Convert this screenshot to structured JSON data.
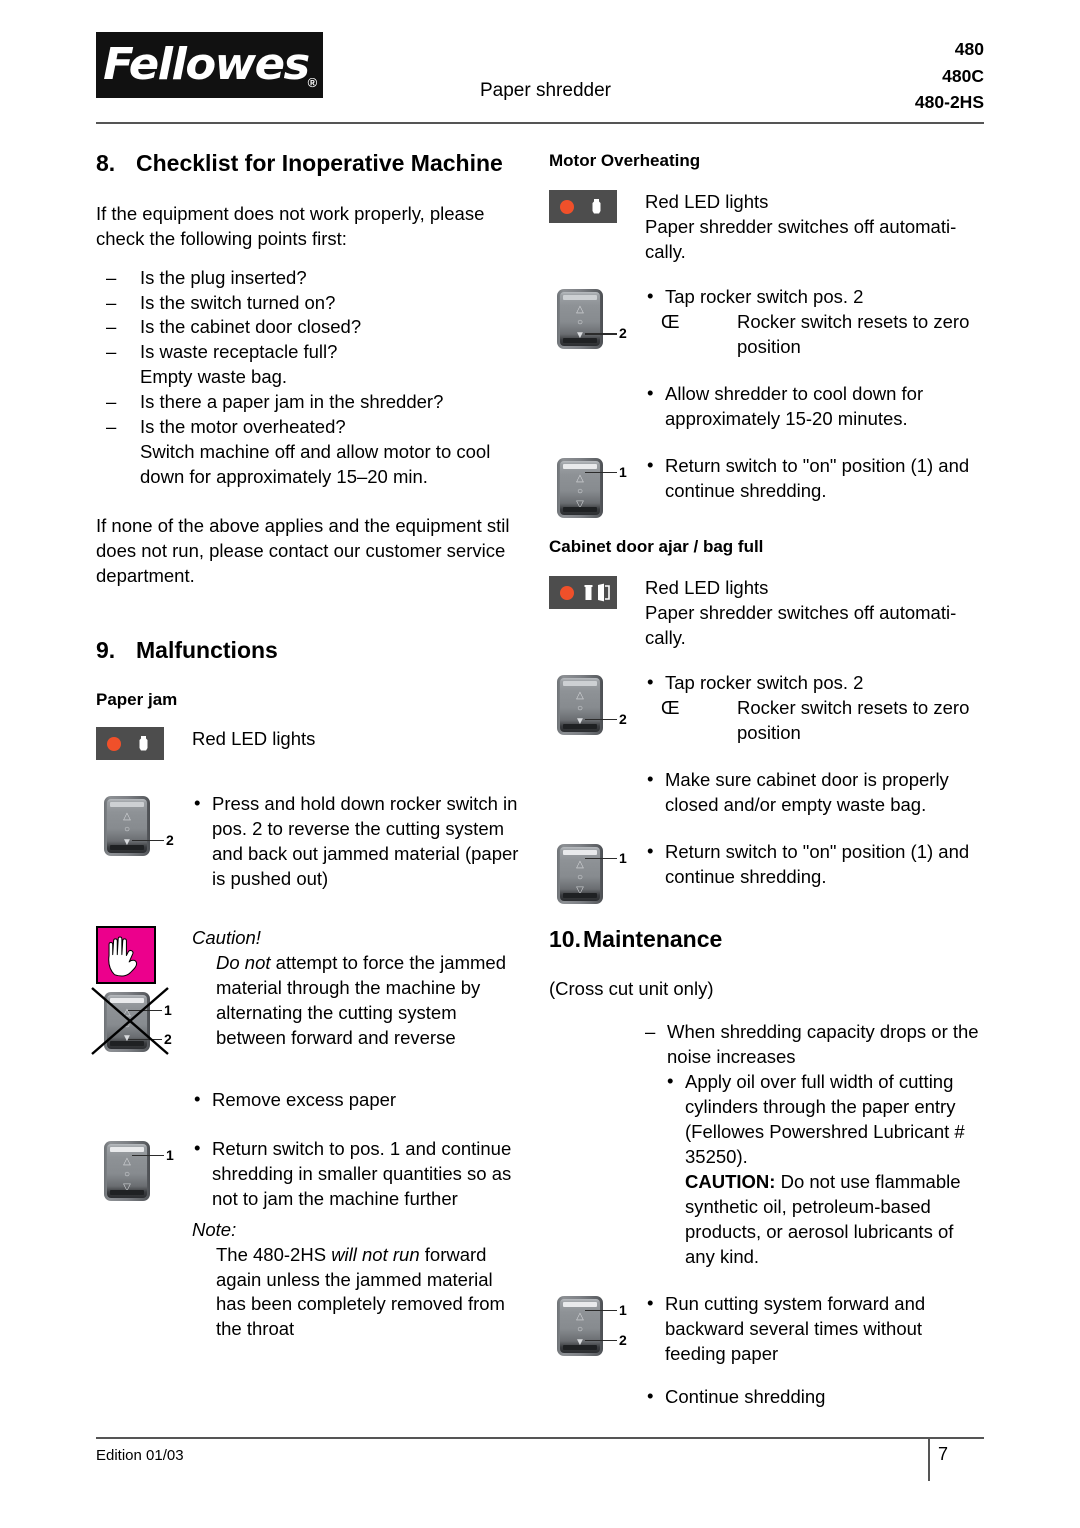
{
  "header": {
    "logo_text": "Fellowes",
    "logo_reg": "®",
    "subtitle": "Paper shredder",
    "models": [
      "480",
      "480C",
      "480-2HS"
    ]
  },
  "left_column": {
    "section8": {
      "number": "8.",
      "title": "Checklist for Inoperative Machine",
      "intro": "If  the equipment does not work properly, please check the following points first:",
      "checklist": [
        "Is the plug inserted?",
        "Is the switch turned on?",
        "Is the cabinet door closed?",
        "Is waste receptacle full?",
        "Is there a paper jam in the shredder?",
        "Is the motor overheated?"
      ],
      "checklist_note_waste": "Empty waste bag.",
      "checklist_note_motor": "Switch machine off and allow motor to cool down for approximately 15–20 min.",
      "closing": "If none of the above applies and the equipment stil does not run, please contact our customer service department."
    },
    "section9": {
      "number": "9.",
      "title": "Malfunctions",
      "paper_jam": {
        "heading": "Paper jam",
        "led_text": "Red LED lights",
        "bullet1": "Press and hold down rocker switch in pos. 2 to reverse the cutting system and back out jammed material (paper is pushed out)",
        "switch1_label": "2",
        "caution_title": "Caution!",
        "caution_emph": "Do not",
        "caution_body": " attempt to force the jammed material through the machine by alternating the cutting system between forward and reverse",
        "crossed_label_1": "1",
        "crossed_label_2": "2",
        "bullet2": "Remove excess paper",
        "bullet3": "Return switch to pos. 1 and continue shredding in smaller quantities so as not to jam the machine further",
        "switch2_label": "1",
        "note_title": "Note:",
        "note_pre": "The 480-2HS ",
        "note_emph": "will not run",
        "note_post": " forward again unless the jammed material has been completely removed from the throat"
      }
    }
  },
  "right_column": {
    "motor_overheating": {
      "heading": "Motor Overheating",
      "led_text_1": "Red LED lights",
      "led_text_2": "Paper shredder switches off automati-",
      "led_text_3": "cally.",
      "bullet1": "Tap rocker switch pos. 2",
      "arrow_glyph": "Œ",
      "arrow_text": "Rocker switch resets to zero position",
      "switch1_label": "2",
      "bullet2": "Allow shredder to cool down for approximately 15-20 minutes.",
      "bullet3": "Return switch to \"on\" position (1) and continue shredding.",
      "switch2_label": "1"
    },
    "cabinet_door": {
      "heading": "Cabinet door ajar / bag full",
      "led_text_1": "Red LED lights",
      "led_text_2": "Paper shredder switches off automati-",
      "led_text_3": "cally.",
      "bullet1": "Tap rocker switch pos. 2",
      "arrow_glyph": "Œ",
      "arrow_text": "Rocker switch resets to zero position",
      "switch1_label": "2",
      "bullet2": "Make sure cabinet door is properly closed and/or empty waste bag.",
      "bullet3": "Return switch to \"on\" position (1) and continue shredding.",
      "switch2_label": "1"
    },
    "section10": {
      "number": "10.",
      "title": "Maintenance",
      "subtitle": "(Cross cut unit only)",
      "dash_item": "When shredding capacity drops or the noise increases",
      "bullet_oil": "Apply oil over full width of cutting cylinders through the paper entry (Fellowes Powershred Lubricant # 35250).",
      "caution_label": "CAUTION:",
      "caution_text": " Do not use flammable synthetic oil, petroleum-based products, or aerosol lubricants of any kind.",
      "bullet_run": "Run cutting system forward and backward several times without feeding paper",
      "switch_label_1": "1",
      "switch_label_2": "2",
      "bullet_continue": "Continue shredding"
    }
  },
  "footer": {
    "edition": "Edition 01/03",
    "page": "7"
  },
  "colors": {
    "led_panel_bg": "#4d4d4d",
    "led_red": "#f0502a",
    "caution_magenta": "#ec008c",
    "rule": "#555555"
  },
  "icons": {
    "led_panel": "led-indicator-panel-icon",
    "bag": "waste-bag-icon",
    "bin": "waste-bin-icon",
    "door": "open-door-icon",
    "rocker": "rocker-switch-icon",
    "hand": "stop-hand-caution-icon",
    "cross": "cross-out-icon"
  }
}
